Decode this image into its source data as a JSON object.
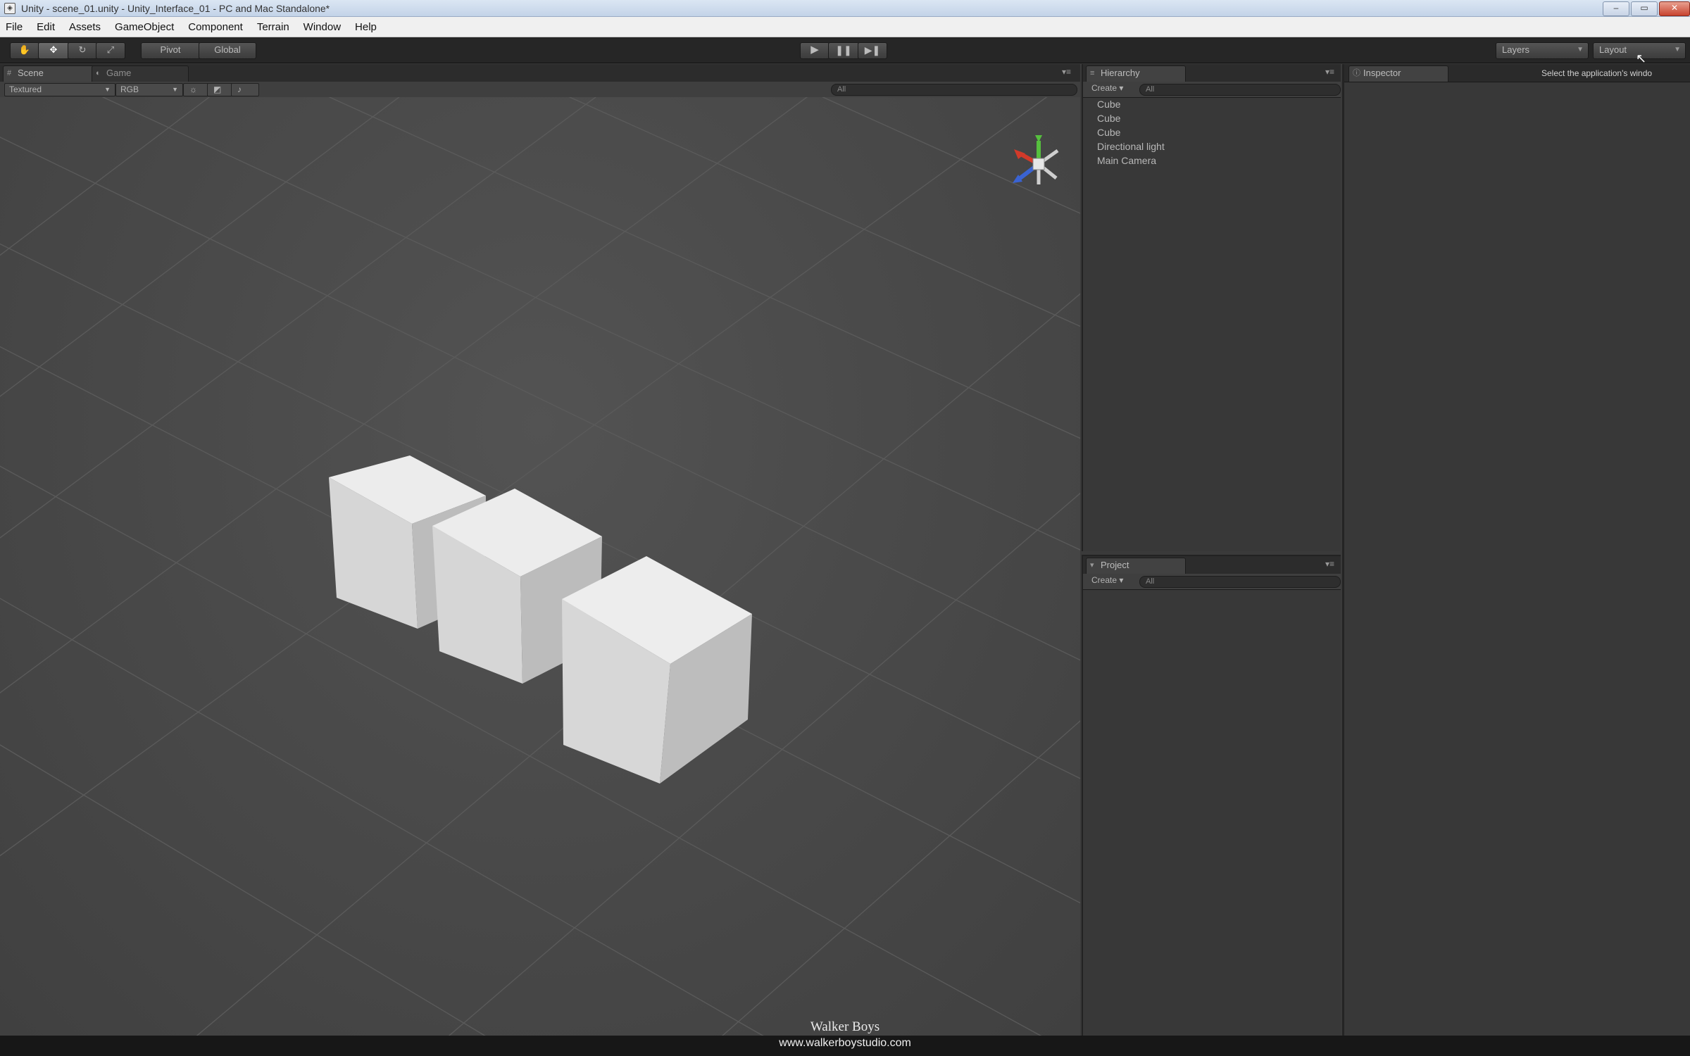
{
  "window": {
    "title": "Unity - scene_01.unity - Unity_Interface_01 - PC and Mac Standalone*",
    "app_icon": "unity-logo-icon",
    "controls": [
      "minimize-icon",
      "maximize-icon",
      "close-icon"
    ]
  },
  "menu": [
    "File",
    "Edit",
    "Assets",
    "GameObject",
    "Component",
    "Terrain",
    "Window",
    "Help"
  ],
  "toolbar": {
    "pivot_label": "Pivot",
    "global_label": "Global",
    "layers_label": "Layers",
    "layout_label": "Layout"
  },
  "scene_panel": {
    "tabs": [
      "Scene",
      "Game"
    ],
    "shading_mode": "Textured",
    "render_mode": "RGB",
    "search_placeholder": "All"
  },
  "hierarchy": {
    "tab": "Hierarchy",
    "create_label": "Create",
    "search_placeholder": "All",
    "items": [
      "Cube",
      "Cube",
      "Cube",
      "Directional light",
      "Main Camera"
    ]
  },
  "project": {
    "tab": "Project",
    "create_label": "Create",
    "search_placeholder": "All"
  },
  "inspector": {
    "tab": "Inspector",
    "tooltip": "Select the application's windo"
  },
  "credit": {
    "title": "Walker Boys",
    "url": "www.walkerboystudio.com"
  },
  "colors": {
    "background": "#3a3a3a",
    "toolbar": "#262626",
    "cube_top": "#ececec",
    "cube_left": "#d8d8d8",
    "cube_right": "#bdbdbd",
    "gizmo_x": "#d23a2a",
    "gizmo_y": "#56c03e",
    "gizmo_z": "#3a63d2"
  }
}
